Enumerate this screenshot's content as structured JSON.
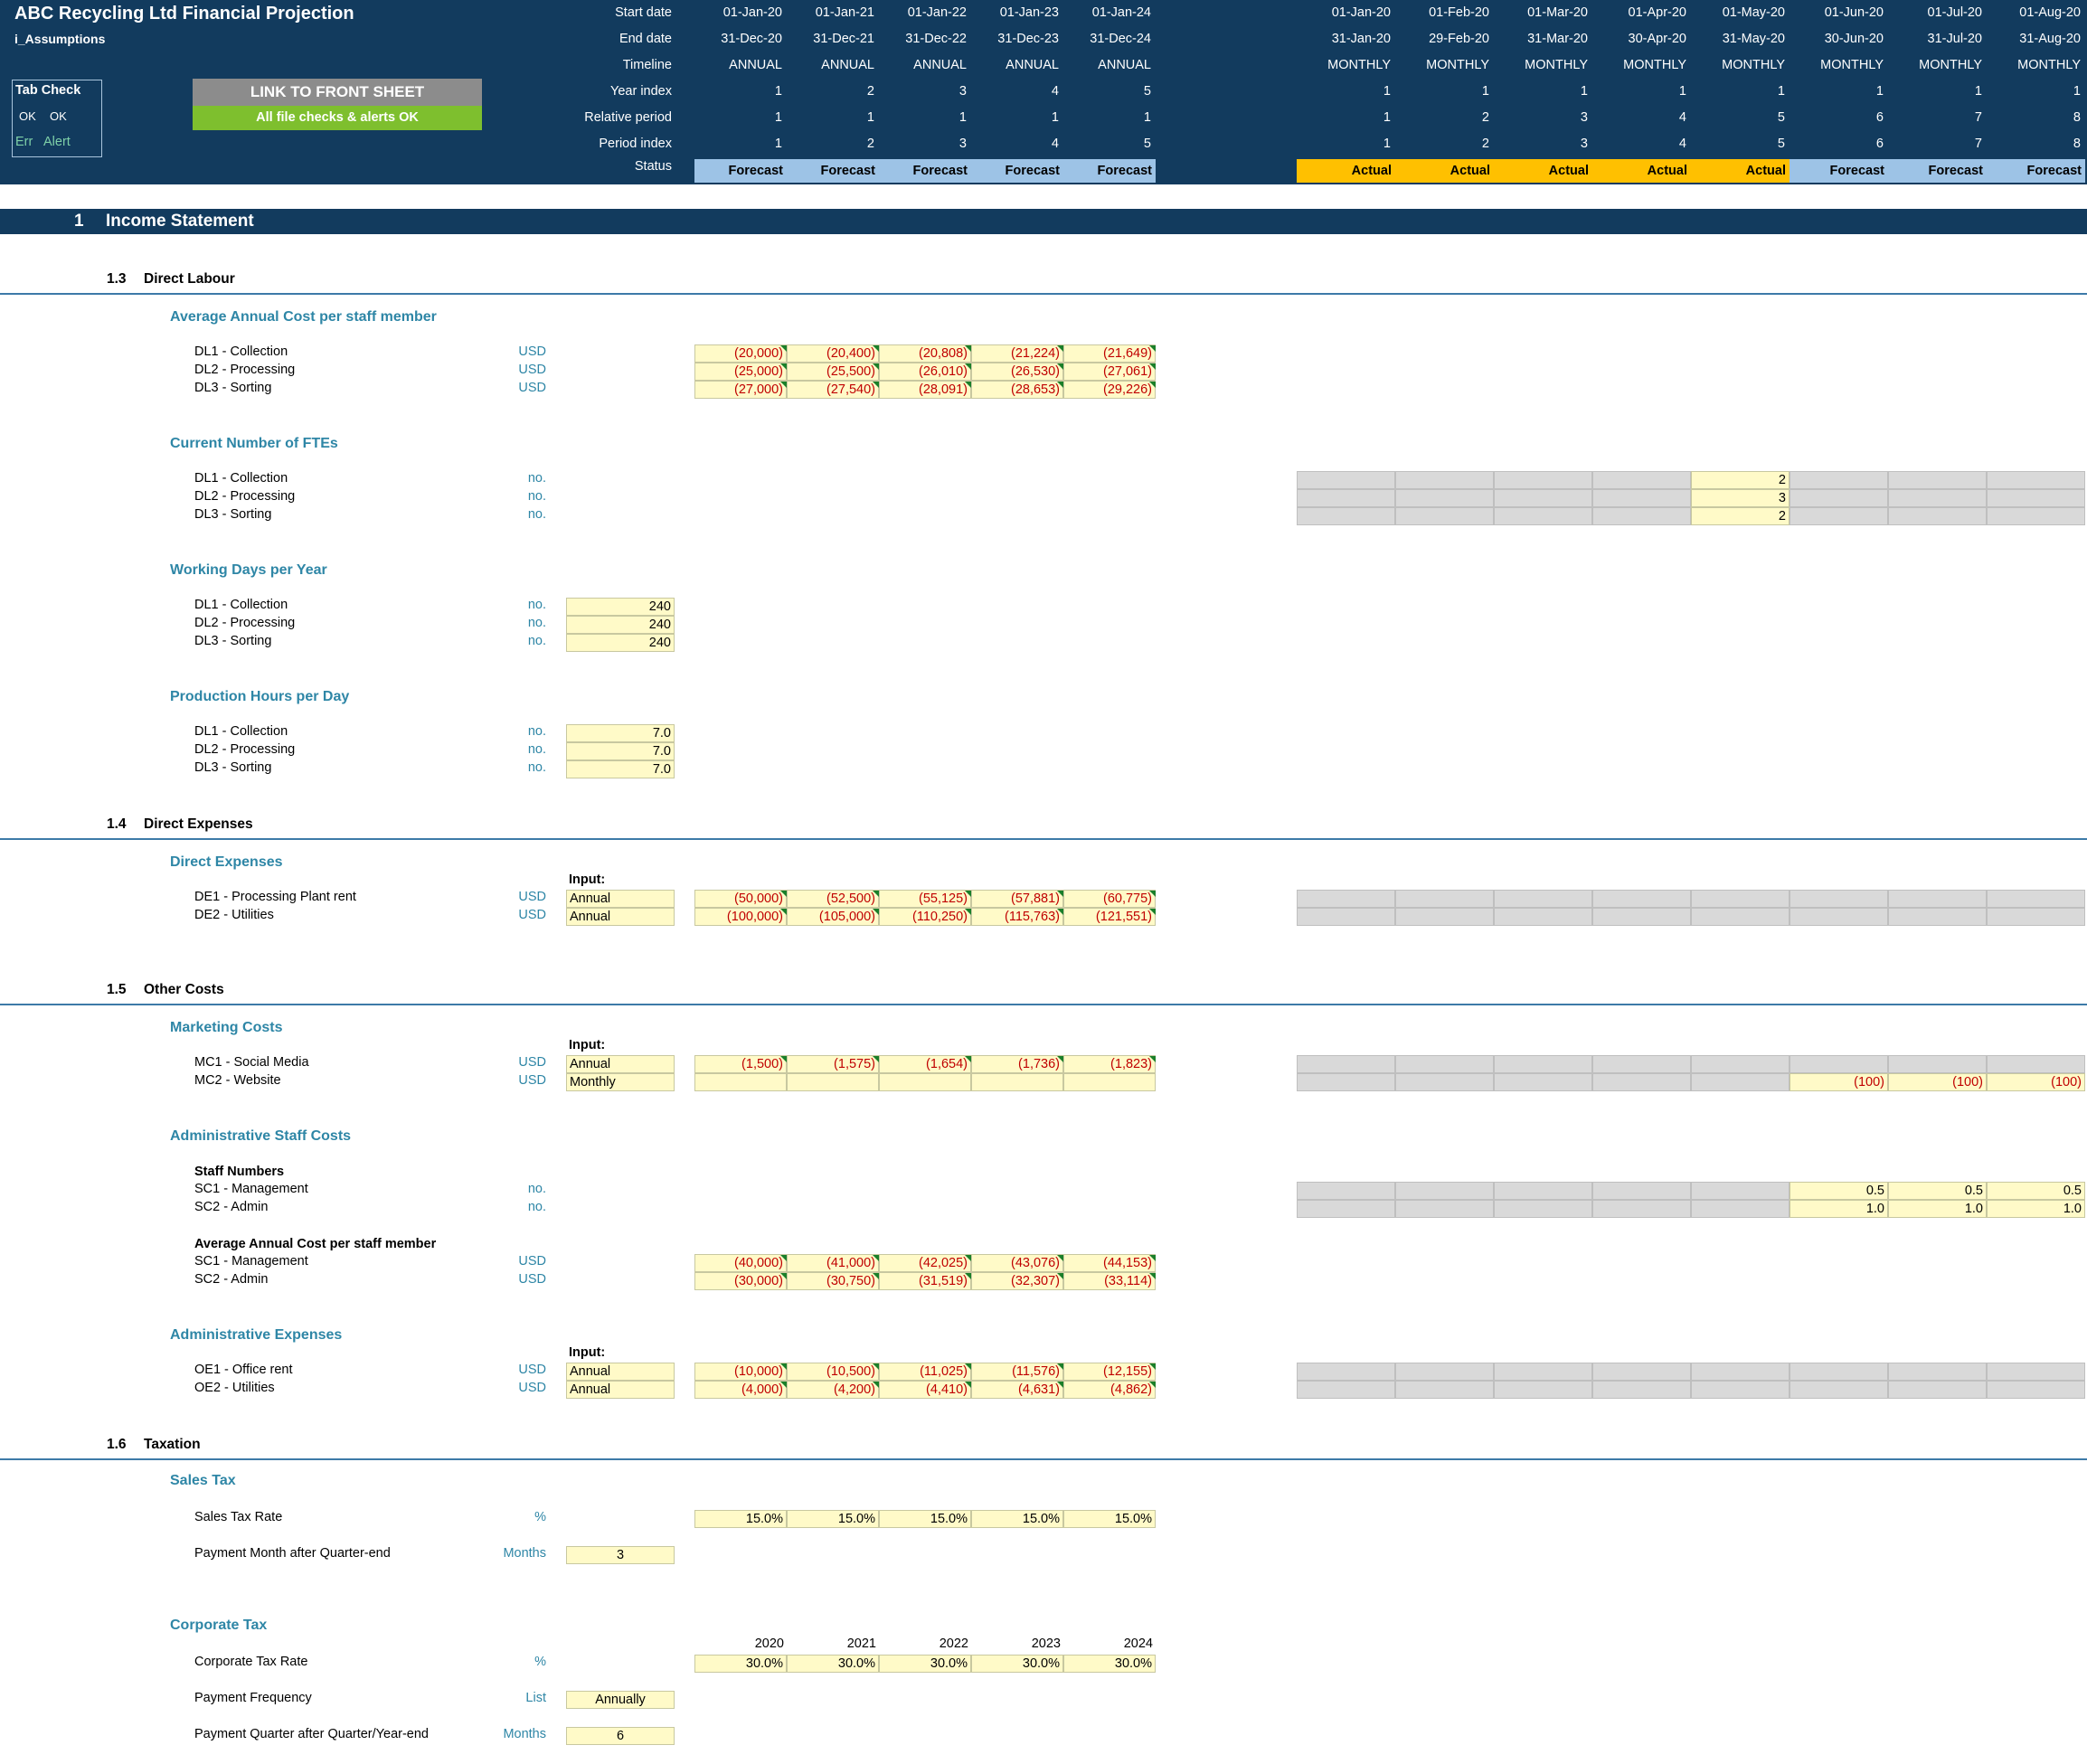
{
  "header": {
    "title": "ABC Recycling Ltd Financial Projection",
    "sheet_name": "i_Assumptions",
    "tab_check": {
      "title": "Tab Check",
      "ok1": "OK",
      "ok2": "OK",
      "err": "Err",
      "alert": "Alert"
    },
    "link_button": "LINK TO FRONT SHEET",
    "checks_status": "All file checks & alerts OK",
    "row_labels": [
      "Start date",
      "End date",
      "Timeline",
      "Year index",
      "Relative period",
      "Period index",
      "Status"
    ],
    "annual_cols": [
      {
        "start": "01-Jan-20",
        "end": "31-Dec-20",
        "timeline": "ANNUAL",
        "year_index": "1",
        "relative": "1",
        "period": "1",
        "status": "Forecast"
      },
      {
        "start": "01-Jan-21",
        "end": "31-Dec-21",
        "timeline": "ANNUAL",
        "year_index": "2",
        "relative": "1",
        "period": "2",
        "status": "Forecast"
      },
      {
        "start": "01-Jan-22",
        "end": "31-Dec-22",
        "timeline": "ANNUAL",
        "year_index": "3",
        "relative": "1",
        "period": "3",
        "status": "Forecast"
      },
      {
        "start": "01-Jan-23",
        "end": "31-Dec-23",
        "timeline": "ANNUAL",
        "year_index": "4",
        "relative": "1",
        "period": "4",
        "status": "Forecast"
      },
      {
        "start": "01-Jan-24",
        "end": "31-Dec-24",
        "timeline": "ANNUAL",
        "year_index": "5",
        "relative": "1",
        "period": "5",
        "status": "Forecast"
      }
    ],
    "monthly_cols": [
      {
        "start": "01-Jan-20",
        "end": "31-Jan-20",
        "timeline": "MONTHLY",
        "year_index": "1",
        "relative": "1",
        "period": "1",
        "status": "Actual"
      },
      {
        "start": "01-Feb-20",
        "end": "29-Feb-20",
        "timeline": "MONTHLY",
        "year_index": "1",
        "relative": "2",
        "period": "2",
        "status": "Actual"
      },
      {
        "start": "01-Mar-20",
        "end": "31-Mar-20",
        "timeline": "MONTHLY",
        "year_index": "1",
        "relative": "3",
        "period": "3",
        "status": "Actual"
      },
      {
        "start": "01-Apr-20",
        "end": "30-Apr-20",
        "timeline": "MONTHLY",
        "year_index": "1",
        "relative": "4",
        "period": "4",
        "status": "Actual"
      },
      {
        "start": "01-May-20",
        "end": "31-May-20",
        "timeline": "MONTHLY",
        "year_index": "1",
        "relative": "5",
        "period": "5",
        "status": "Actual"
      },
      {
        "start": "01-Jun-20",
        "end": "30-Jun-20",
        "timeline": "MONTHLY",
        "year_index": "1",
        "relative": "6",
        "period": "6",
        "status": "Forecast"
      },
      {
        "start": "01-Jul-20",
        "end": "31-Jul-20",
        "timeline": "MONTHLY",
        "year_index": "1",
        "relative": "7",
        "period": "7",
        "status": "Forecast"
      },
      {
        "start": "01-Aug-20",
        "end": "31-Aug-20",
        "timeline": "MONTHLY",
        "year_index": "1",
        "relative": "8",
        "period": "8",
        "status": "Forecast"
      }
    ]
  },
  "colors": {
    "navy": "#123b5e",
    "forecast": "#9dc3e6",
    "actual": "#ffc000",
    "green": "#7ebf2e",
    "input": "#fffac8",
    "teal": "#2e86a6",
    "negative": "#c00000"
  },
  "section1": {
    "num": "1",
    "title": "Income Statement"
  },
  "s13": {
    "num": "1.3",
    "title": "Direct Labour",
    "avg_cost": {
      "title": "Average Annual Cost per staff member",
      "rows": [
        {
          "label": "DL1 - Collection",
          "unit": "USD",
          "values": [
            "(20,000)",
            "(20,400)",
            "(20,808)",
            "(21,224)",
            "(21,649)"
          ]
        },
        {
          "label": "DL2 - Processing",
          "unit": "USD",
          "values": [
            "(25,000)",
            "(25,500)",
            "(26,010)",
            "(26,530)",
            "(27,061)"
          ]
        },
        {
          "label": "DL3 - Sorting",
          "unit": "USD",
          "values": [
            "(27,000)",
            "(27,540)",
            "(28,091)",
            "(28,653)",
            "(29,226)"
          ]
        }
      ]
    },
    "ftes": {
      "title": "Current Number of FTEs",
      "rows": [
        {
          "label": "DL1 - Collection",
          "unit": "no.",
          "value": "2"
        },
        {
          "label": "DL2 - Processing",
          "unit": "no.",
          "value": "3"
        },
        {
          "label": "DL3 - Sorting",
          "unit": "no.",
          "value": "2"
        }
      ]
    },
    "working_days": {
      "title": "Working Days per Year",
      "rows": [
        {
          "label": "DL1 - Collection",
          "unit": "no.",
          "value": "240"
        },
        {
          "label": "DL2 - Processing",
          "unit": "no.",
          "value": "240"
        },
        {
          "label": "DL3 - Sorting",
          "unit": "no.",
          "value": "240"
        }
      ]
    },
    "prod_hours": {
      "title": "Production Hours per Day",
      "rows": [
        {
          "label": "DL1 - Collection",
          "unit": "no.",
          "value": "7.0"
        },
        {
          "label": "DL2 - Processing",
          "unit": "no.",
          "value": "7.0"
        },
        {
          "label": "DL3 - Sorting",
          "unit": "no.",
          "value": "7.0"
        }
      ]
    }
  },
  "s14": {
    "num": "1.4",
    "title": "Direct Expenses",
    "direct": {
      "title": "Direct Expenses",
      "input_label": "Input:",
      "rows": [
        {
          "label": "DE1 - Processing Plant rent",
          "unit": "USD",
          "input": "Annual",
          "values": [
            "(50,000)",
            "(52,500)",
            "(55,125)",
            "(57,881)",
            "(60,775)"
          ]
        },
        {
          "label": "DE2 - Utilities",
          "unit": "USD",
          "input": "Annual",
          "values": [
            "(100,000)",
            "(105,000)",
            "(110,250)",
            "(115,763)",
            "(121,551)"
          ]
        }
      ]
    }
  },
  "s15": {
    "num": "1.5",
    "title": "Other Costs",
    "marketing": {
      "title": "Marketing Costs",
      "input_label": "Input:",
      "rows": [
        {
          "label": "MC1 - Social Media",
          "unit": "USD",
          "input": "Annual",
          "values": [
            "(1,500)",
            "(1,575)",
            "(1,654)",
            "(1,736)",
            "(1,823)"
          ]
        },
        {
          "label": "MC2 - Website",
          "unit": "USD",
          "input": "Monthly",
          "monthly": [
            "(100)",
            "(100)",
            "(100)"
          ]
        }
      ]
    },
    "admin_staff": {
      "title": "Administrative Staff Costs",
      "numbers_title": "Staff Numbers",
      "numbers": [
        {
          "label": "SC1 - Management",
          "unit": "no.",
          "monthly": [
            "0.5",
            "0.5",
            "0.5"
          ]
        },
        {
          "label": "SC2 - Admin",
          "unit": "no.",
          "monthly": [
            "1.0",
            "1.0",
            "1.0"
          ]
        }
      ],
      "cost_title": "Average Annual Cost per staff member",
      "costs": [
        {
          "label": "SC1 - Management",
          "unit": "USD",
          "values": [
            "(40,000)",
            "(41,000)",
            "(42,025)",
            "(43,076)",
            "(44,153)"
          ]
        },
        {
          "label": "SC2 - Admin",
          "unit": "USD",
          "values": [
            "(30,000)",
            "(30,750)",
            "(31,519)",
            "(32,307)",
            "(33,114)"
          ]
        }
      ]
    },
    "admin_exp": {
      "title": "Administrative Expenses",
      "input_label": "Input:",
      "rows": [
        {
          "label": "OE1 - Office rent",
          "unit": "USD",
          "input": "Annual",
          "values": [
            "(10,000)",
            "(10,500)",
            "(11,025)",
            "(11,576)",
            "(12,155)"
          ]
        },
        {
          "label": "OE2 - Utilities",
          "unit": "USD",
          "input": "Annual",
          "values": [
            "(4,000)",
            "(4,200)",
            "(4,410)",
            "(4,631)",
            "(4,862)"
          ]
        }
      ]
    }
  },
  "s16": {
    "num": "1.6",
    "title": "Taxation",
    "sales_tax": {
      "title": "Sales Tax",
      "rate": {
        "label": "Sales Tax Rate",
        "unit": "%",
        "values": [
          "15.0%",
          "15.0%",
          "15.0%",
          "15.0%",
          "15.0%"
        ]
      },
      "payment": {
        "label": "Payment Month after Quarter-end",
        "unit": "Months",
        "value": "3"
      }
    },
    "corp_tax": {
      "title": "Corporate Tax",
      "years": [
        "2020",
        "2021",
        "2022",
        "2023",
        "2024"
      ],
      "rate": {
        "label": "Corporate Tax Rate",
        "unit": "%",
        "values": [
          "30.0%",
          "30.0%",
          "30.0%",
          "30.0%",
          "30.0%"
        ]
      },
      "frequency": {
        "label": "Payment Frequency",
        "unit": "List",
        "value": "Annually"
      },
      "quarter": {
        "label": "Payment Quarter after Quarter/Year-end",
        "unit": "Months",
        "value": "6"
      }
    }
  }
}
